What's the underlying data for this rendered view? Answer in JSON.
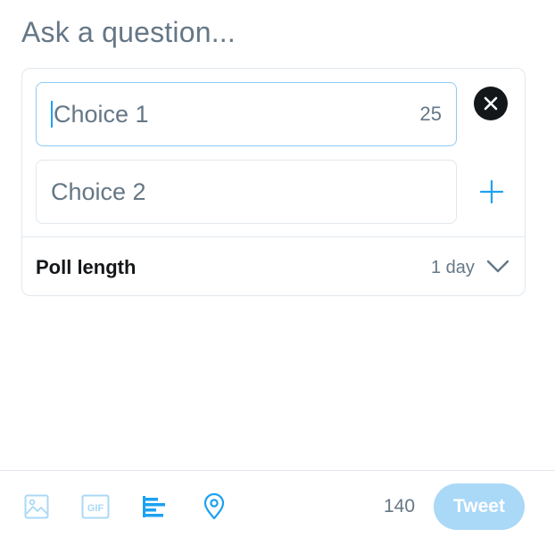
{
  "compose": {
    "question_placeholder": "Ask a question..."
  },
  "poll": {
    "choices": [
      {
        "placeholder": "Choice 1",
        "remaining_chars": "25",
        "focused": true
      },
      {
        "placeholder": "Choice 2"
      }
    ],
    "length_label": "Poll length",
    "length_value": "1 day"
  },
  "toolbar": {
    "icons": [
      "photo-icon",
      "gif-icon",
      "poll-icon",
      "location-icon"
    ],
    "char_remaining": "140",
    "tweet_label": "Tweet"
  },
  "colors": {
    "accent": "#1da1f2",
    "accent_disabled": "#aad8f7",
    "muted_text": "#657786",
    "border": "#e1e8ed"
  }
}
